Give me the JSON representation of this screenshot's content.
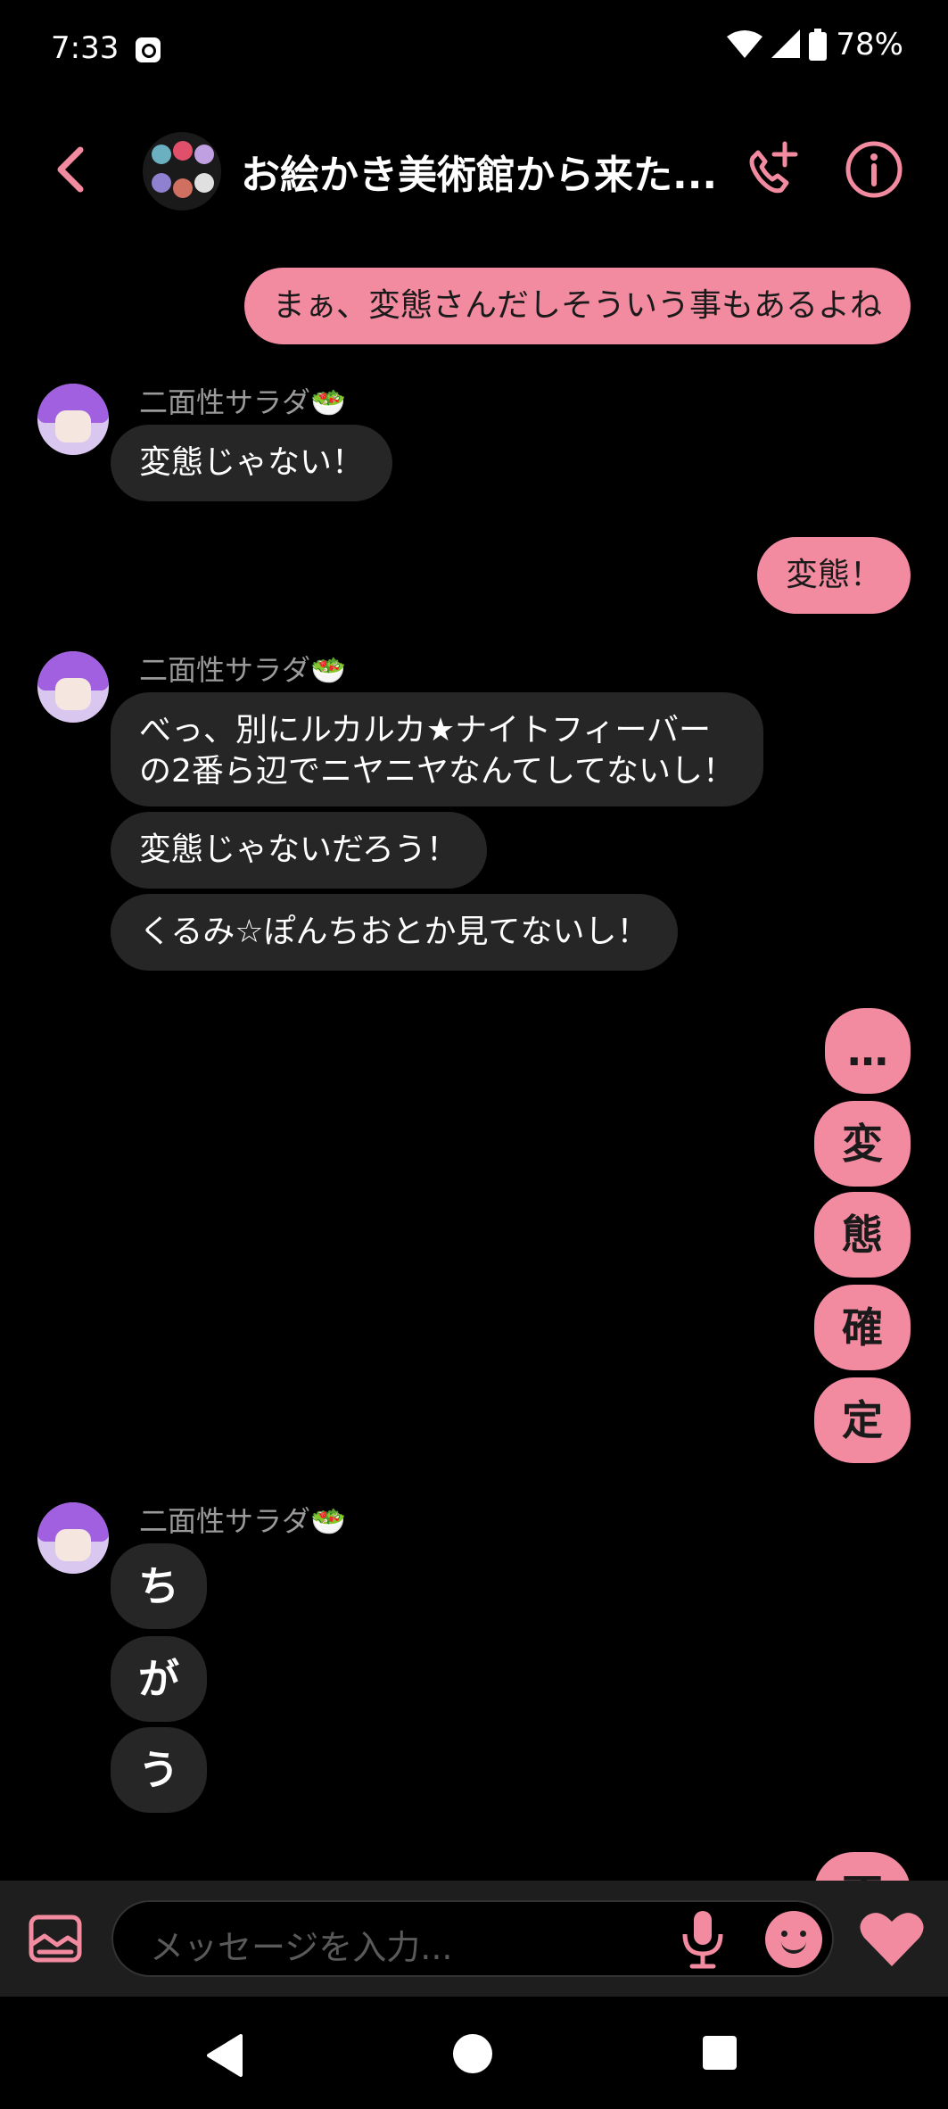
{
  "status_bar": {
    "time": "7:33",
    "battery": "78%"
  },
  "header": {
    "title": "お絵かき美術館から来た..."
  },
  "messages": {
    "out1": "まぁ、変態さんだしそういう事もあるよね",
    "sender1": "二面性サラダ🥗",
    "in1": "変態じゃない！",
    "out2": "変態！",
    "sender2": "二面性サラダ🥗",
    "in2_line1": "べっ、別にルカルカ★ナイトフィーバー",
    "in2_line2": "の2番ら辺でニヤニヤなんてしてないし！",
    "in3": "変態じゃないだろう！",
    "in4": "くるみ☆ぽんちおとか見てないし！",
    "out_chars": [
      "…",
      "変",
      "態",
      "確",
      "定"
    ],
    "sender3": "二面性サラダ🥗",
    "in_chars": [
      "ち",
      "が",
      "う"
    ],
    "out_partial": "否"
  },
  "input": {
    "placeholder": "メッセージを入力..."
  },
  "colors": {
    "accent": "#f28aa0",
    "incoming_bubble": "#262626"
  }
}
